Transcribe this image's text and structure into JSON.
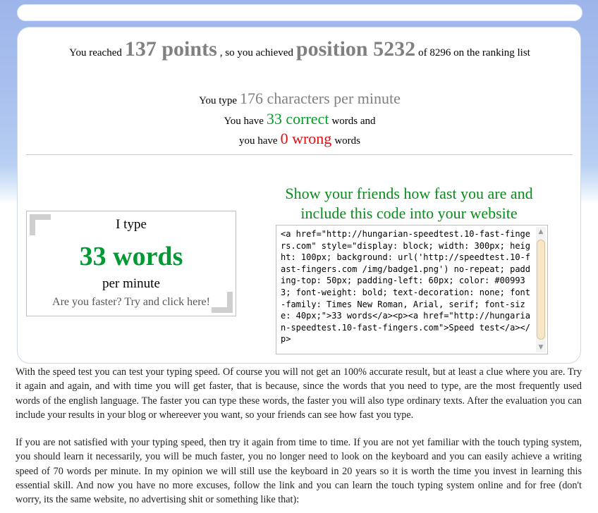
{
  "result": {
    "reached_prefix": "You reached",
    "points": "137 points",
    "achieved_mid": ", so you achieved",
    "position": "position 5232",
    "ranking_suffix": "of 8296 on the ranking list"
  },
  "speed": {
    "type_prefix": "You type",
    "cpm": "176 characters per minute",
    "have_prefix": "You have",
    "correct": "33 correct",
    "correct_suffix": "words and",
    "have_prefix2": "you have",
    "wrong": "0 wrong",
    "wrong_suffix": "words"
  },
  "badge": {
    "line1": "I type",
    "line2": "33 words",
    "line3": "per minute",
    "line4": "Are you faster? Try and click here!"
  },
  "share": {
    "title": "Show your friends how fast you are and include this code into your website",
    "code": "<a href=\"http://hungarian-speedtest.10-fast-fingers.com\" style=\"display: block; width: 300px; height: 100px; background: url('http://speedtest.10-fast-fingers.com /img/badge1.png') no-repeat; padding-top: 50px; padding-left: 60px; color: #009933; font-weight: bold; text-decoration: none; font-family: Times New Roman, Arial, serif; font-size: 40px;\">33 words</a><p><a href=\"http://hungarian-speedtest.10-fast-fingers.com\">Speed test</a></p>"
  },
  "paragraphs": {
    "p1": "With the speed test you can test your typing speed. Of course you will not get an 100% accurate result, but at least a clue where you are. Try it again and again, and with time you will get faster, that is because, since the words that you need to type, are the most frequently used words of the english language. The faster you can type these words, the faster you will also type ordinary texts. After the evaluation you can include your results in your blog or whereever you want, so your friends can see how fast you type.",
    "p2": "If you are not satisfied with your typing speed, then try it again from time to time. If you are not yet familiar with the touch typing system, you should learn it necessarily, you will be much faster, you no longer need to look on the keyboard and you can easily achieve a writing speed of 70 words per minute. In my opinion we will still use the keyboard in 20 years so it is worth the time you invest in learning this essential skill. And now you have no more excuses, follow the link and you can learn the touch typing system online and for free (don't worry, its the same website, no advertising shit or something like that):"
  },
  "colors": {
    "accent_green": "#069c2c",
    "error_red": "#e01010",
    "muted_grey": "#808080",
    "bg_blue": "#a9c0ee"
  }
}
